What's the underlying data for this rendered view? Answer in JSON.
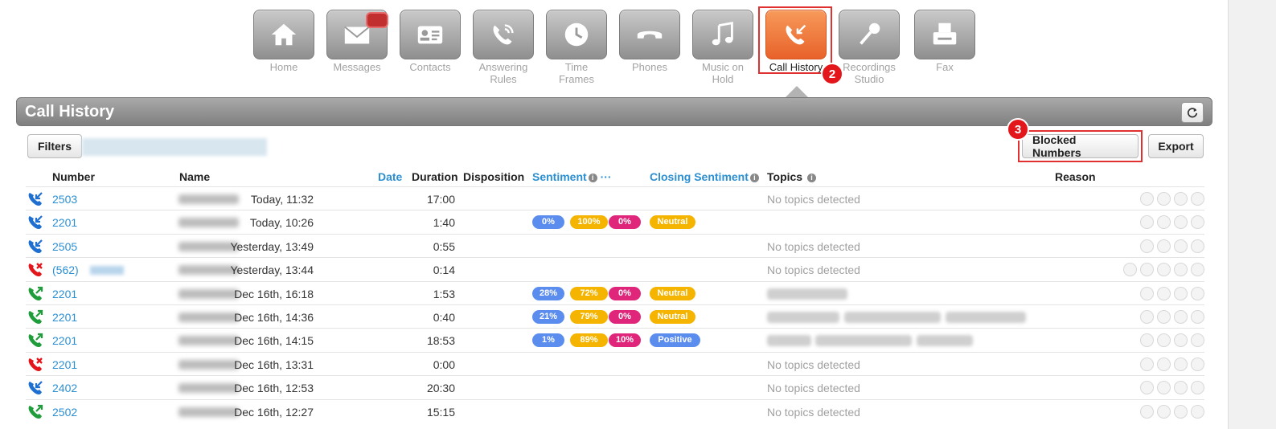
{
  "nav": {
    "tiles": [
      {
        "label": "Home",
        "icon": "home-icon"
      },
      {
        "label": "Messages",
        "icon": "envelope-icon"
      },
      {
        "label": "Contacts",
        "icon": "contact-card-icon"
      },
      {
        "label": "Answering\nRules",
        "icon": "answering-rules-icon"
      },
      {
        "label": "Time\nFrames",
        "icon": "clock-icon"
      },
      {
        "label": "Phones",
        "icon": "phone-handset-icon"
      },
      {
        "label": "Music on\nHold",
        "icon": "music-note-icon"
      },
      {
        "label": "Call History",
        "icon": "call-history-icon",
        "active": true
      },
      {
        "label": "Recordings\nStudio",
        "icon": "microphone-icon"
      },
      {
        "label": "Fax",
        "icon": "fax-icon"
      }
    ],
    "step_badge_call_history": "2"
  },
  "header": {
    "title": "Call History",
    "refresh_icon": "refresh-icon"
  },
  "toolbar": {
    "filters_label": "Filters",
    "blocked_numbers_label": "Blocked Numbers",
    "export_label": "Export",
    "step_badge_blocked": "3"
  },
  "table": {
    "columns": {
      "number": "Number",
      "name": "Name",
      "date": "Date",
      "duration": "Duration",
      "disposition": "Disposition",
      "sentiment": "Sentiment",
      "sentiment_more": "···",
      "closing_sentiment": "Closing Sentiment",
      "topics": "Topics",
      "reason": "Reason"
    },
    "rows": [
      {
        "direction": "inbound",
        "number": "2503",
        "date": "Today, 11:32",
        "duration": "17:00",
        "topics": "No topics detected"
      },
      {
        "direction": "inbound",
        "number": "2201",
        "date": "Today, 10:26",
        "duration": "1:40",
        "sentiment": [
          "0%",
          "100%",
          "0%"
        ],
        "closing": "Neutral"
      },
      {
        "direction": "inbound",
        "number": "2505",
        "date": "Yesterday, 13:49",
        "duration": "0:55",
        "topics": "No topics detected"
      },
      {
        "direction": "missed",
        "number": "(562)",
        "date": "Yesterday, 13:44",
        "duration": "0:14",
        "topics": "No topics detected"
      },
      {
        "direction": "outbound",
        "number": "2201",
        "date": "Dec 16th, 16:18",
        "duration": "1:53",
        "sentiment": [
          "28%",
          "72%",
          "0%"
        ],
        "closing": "Neutral"
      },
      {
        "direction": "outbound",
        "number": "2201",
        "date": "Dec 16th, 14:36",
        "duration": "0:40",
        "sentiment": [
          "21%",
          "79%",
          "0%"
        ],
        "closing": "Neutral"
      },
      {
        "direction": "outbound",
        "number": "2201",
        "date": "Dec 16th, 14:15",
        "duration": "18:53",
        "sentiment": [
          "1%",
          "89%",
          "10%"
        ],
        "closing": "Positive"
      },
      {
        "direction": "missed",
        "number": "2201",
        "date": "Dec 16th, 13:31",
        "duration": "0:00",
        "topics": "No topics detected"
      },
      {
        "direction": "inbound",
        "number": "2402",
        "date": "Dec 16th, 12:53",
        "duration": "20:30",
        "topics": "No topics detected"
      },
      {
        "direction": "outbound",
        "number": "2502",
        "date": "Dec 16th, 12:27",
        "duration": "15:15",
        "topics": "No topics detected"
      }
    ]
  },
  "colors": {
    "accent_orange": "#e8622a",
    "link_blue": "#2b8fd2",
    "inbound_blue": "#1f6fd1",
    "outbound_green": "#1f9d3a",
    "missed_red": "#e3161b"
  }
}
